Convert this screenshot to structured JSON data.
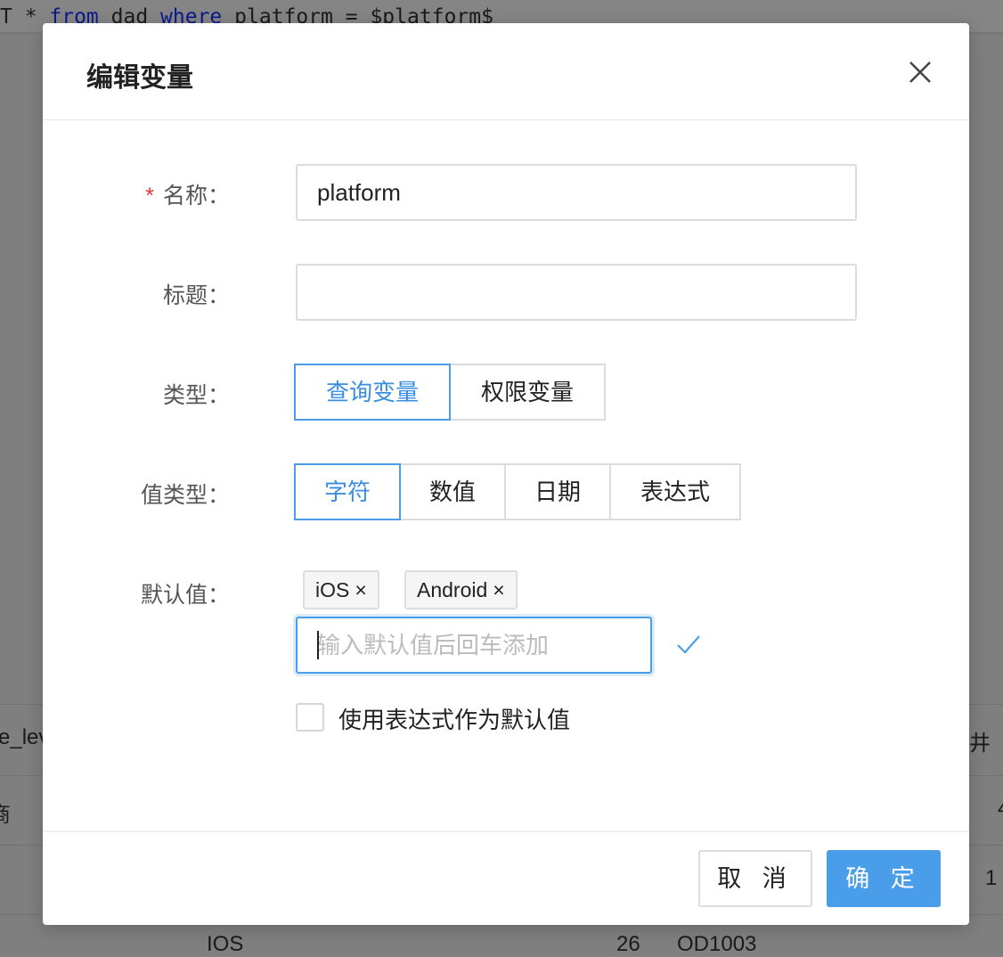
{
  "background": {
    "sql": {
      "a": "T * ",
      "from": "from",
      "b": " dad ",
      "where": "where",
      "c": " platform = $platform$"
    },
    "cells": [
      "e_lev",
      "商",
      "IOS",
      "26",
      "OD1003",
      "井",
      "4",
      "1"
    ]
  },
  "dialog": {
    "title": "编辑变量",
    "close_icon": "close-icon",
    "fields": {
      "name": {
        "label": "名称：",
        "required_mark": "*",
        "value": "platform"
      },
      "title": {
        "label": "标题：",
        "value": ""
      },
      "type": {
        "label": "类型：",
        "options": [
          "查询变量",
          "权限变量"
        ],
        "selected": "查询变量"
      },
      "value_type": {
        "label": "值类型：",
        "options": [
          "字符",
          "数值",
          "日期",
          "表达式"
        ],
        "selected": "字符"
      },
      "default": {
        "label": "默认值：",
        "tags": [
          "iOS",
          "Android"
        ],
        "tag_remove": "×",
        "placeholder": "输入默认值后回车添加",
        "confirm_icon": "check-icon"
      },
      "use_expression": {
        "label": "使用表达式作为默认值",
        "checked": false
      }
    },
    "cancel_label": "取 消",
    "ok_label": "确 定",
    "accent_color": "#4a9de8"
  }
}
